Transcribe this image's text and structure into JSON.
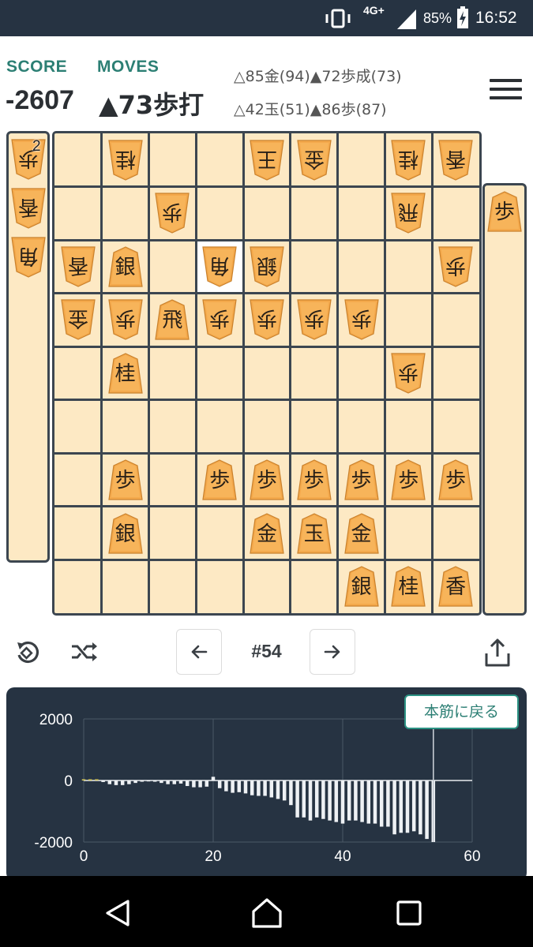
{
  "status_bar": {
    "network": "4G+",
    "battery": "85%",
    "time": "16:52",
    "icons": [
      "vibrate-icon",
      "signal-icon",
      "battery-charging-icon"
    ]
  },
  "header": {
    "score_label": "SCORE",
    "moves_label": "MOVES",
    "score_value": "-2607",
    "current_move": "▲73歩打",
    "history_line1": "△85金(94)▲72歩成(73)",
    "history_line2": "△42玉(51)▲86歩(87)"
  },
  "board": {
    "files": 9,
    "ranks": 9,
    "highlight": {
      "file": 6,
      "rank": 3
    },
    "pieces": [
      {
        "file": 8,
        "rank": 1,
        "char": "桂",
        "side": "gote"
      },
      {
        "file": 5,
        "rank": 1,
        "char": "王",
        "side": "gote"
      },
      {
        "file": 4,
        "rank": 1,
        "char": "金",
        "side": "gote"
      },
      {
        "file": 2,
        "rank": 1,
        "char": "桂",
        "side": "gote"
      },
      {
        "file": 1,
        "rank": 1,
        "char": "香",
        "side": "gote"
      },
      {
        "file": 7,
        "rank": 2,
        "char": "歩",
        "side": "gote"
      },
      {
        "file": 2,
        "rank": 2,
        "char": "飛",
        "side": "gote"
      },
      {
        "file": 9,
        "rank": 3,
        "char": "香",
        "side": "gote"
      },
      {
        "file": 8,
        "rank": 3,
        "char": "銀",
        "side": "sente"
      },
      {
        "file": 6,
        "rank": 3,
        "char": "角",
        "side": "gote"
      },
      {
        "file": 5,
        "rank": 3,
        "char": "銀",
        "side": "gote"
      },
      {
        "file": 1,
        "rank": 3,
        "char": "歩",
        "side": "gote"
      },
      {
        "file": 9,
        "rank": 4,
        "char": "金",
        "side": "gote"
      },
      {
        "file": 8,
        "rank": 4,
        "char": "歩",
        "side": "gote"
      },
      {
        "file": 7,
        "rank": 4,
        "char": "飛",
        "side": "sente"
      },
      {
        "file": 6,
        "rank": 4,
        "char": "歩",
        "side": "gote"
      },
      {
        "file": 5,
        "rank": 4,
        "char": "歩",
        "side": "gote"
      },
      {
        "file": 4,
        "rank": 4,
        "char": "歩",
        "side": "gote"
      },
      {
        "file": 3,
        "rank": 4,
        "char": "歩",
        "side": "gote"
      },
      {
        "file": 8,
        "rank": 5,
        "char": "桂",
        "side": "sente"
      },
      {
        "file": 2,
        "rank": 5,
        "char": "歩",
        "side": "gote"
      },
      {
        "file": 8,
        "rank": 7,
        "char": "歩",
        "side": "sente"
      },
      {
        "file": 6,
        "rank": 7,
        "char": "歩",
        "side": "sente"
      },
      {
        "file": 5,
        "rank": 7,
        "char": "歩",
        "side": "sente"
      },
      {
        "file": 4,
        "rank": 7,
        "char": "歩",
        "side": "sente"
      },
      {
        "file": 3,
        "rank": 7,
        "char": "歩",
        "side": "sente"
      },
      {
        "file": 2,
        "rank": 7,
        "char": "歩",
        "side": "sente"
      },
      {
        "file": 1,
        "rank": 7,
        "char": "歩",
        "side": "sente"
      },
      {
        "file": 8,
        "rank": 8,
        "char": "銀",
        "side": "sente"
      },
      {
        "file": 5,
        "rank": 8,
        "char": "金",
        "side": "sente"
      },
      {
        "file": 4,
        "rank": 8,
        "char": "玉",
        "side": "sente"
      },
      {
        "file": 3,
        "rank": 8,
        "char": "金",
        "side": "sente"
      },
      {
        "file": 3,
        "rank": 9,
        "char": "銀",
        "side": "sente"
      },
      {
        "file": 2,
        "rank": 9,
        "char": "桂",
        "side": "sente"
      },
      {
        "file": 1,
        "rank": 9,
        "char": "香",
        "side": "sente"
      }
    ]
  },
  "gote_hand": [
    {
      "char": "歩",
      "count": "2"
    },
    {
      "char": "香",
      "count": ""
    },
    {
      "char": "角",
      "count": ""
    }
  ],
  "sente_hand": [
    {
      "char": "歩",
      "count": ""
    }
  ],
  "controls": {
    "move_number": "#54",
    "prev_icon": "arrow-left-icon",
    "next_icon": "arrow-right-icon",
    "flip_icon": "rotate-board-icon",
    "shuffle_icon": "shuffle-icon",
    "share_icon": "share-icon"
  },
  "graph": {
    "return_button": "本筋に戻る"
  },
  "chart_data": {
    "type": "bar",
    "x_ticks": [
      "0",
      "20",
      "40",
      "60"
    ],
    "y_ticks": [
      "2000",
      "0",
      "-2000"
    ],
    "xlim": [
      0,
      60
    ],
    "ylim": [
      -2000,
      2000
    ],
    "current_move": 54,
    "grid": true,
    "x": [
      0,
      1,
      2,
      3,
      4,
      5,
      6,
      7,
      8,
      9,
      10,
      11,
      12,
      13,
      14,
      15,
      16,
      17,
      18,
      19,
      20,
      21,
      22,
      23,
      24,
      25,
      26,
      27,
      28,
      29,
      30,
      31,
      32,
      33,
      34,
      35,
      36,
      37,
      38,
      39,
      40,
      41,
      42,
      43,
      44,
      45,
      46,
      47,
      48,
      49,
      50,
      51,
      52,
      53,
      54
    ],
    "values": [
      40,
      40,
      40,
      -50,
      -120,
      -150,
      -150,
      -120,
      -80,
      -40,
      -30,
      -40,
      -80,
      -120,
      -120,
      -100,
      -180,
      -220,
      -220,
      -200,
      120,
      -250,
      -350,
      -400,
      -380,
      -420,
      -480,
      -500,
      -500,
      -550,
      -600,
      -650,
      -800,
      -1200,
      -1200,
      -1300,
      -1200,
      -1250,
      -1300,
      -1350,
      -1400,
      -1300,
      -1300,
      -1350,
      -1400,
      -1400,
      -1500,
      -1500,
      -1750,
      -1700,
      -1700,
      -1650,
      -1750,
      -1900,
      -2000
    ]
  }
}
